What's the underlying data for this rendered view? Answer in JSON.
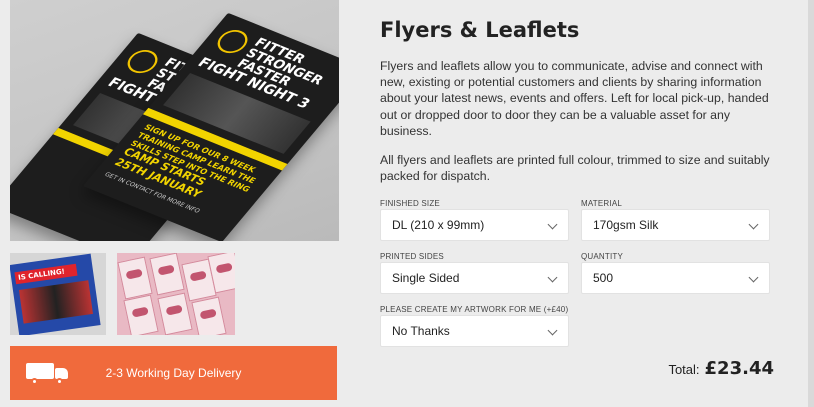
{
  "product": {
    "title": "Flyers & Leaflets",
    "description": "Flyers and leaflets allow you to communicate, advise and connect with new, existing or potential customers and clients by sharing information about your latest news, events and offers. Left for local pick-up, handed out or dropped door to door they can be a valuable asset for any business.",
    "description2": "All flyers and leaflets are printed full colour, trimmed to size and suitably packed for dispatch."
  },
  "gallery": {
    "main_image_icon": "flyer-photo",
    "flyer": {
      "headline": "FITTER STRONGER FASTER",
      "event": "FIGHT NIGHT 3",
      "promo": "SIGN UP FOR OUR 8 WEEK TRAINING CAMP LEARN THE SKILLS STEP INTO THE RING",
      "camp_starts": "CAMP STARTS",
      "date": "25TH JANUARY",
      "contact": "GET IN CONTACT FOR MORE INFO"
    },
    "thumb1_text": "IS CALLING!"
  },
  "delivery": {
    "label": "2-3 Working Day Delivery",
    "icon": "truck-icon",
    "color": "#f06a3c"
  },
  "options": {
    "finished_size": {
      "label": "FINISHED SIZE",
      "value": "DL (210 x 99mm)"
    },
    "material": {
      "label": "MATERIAL",
      "value": "170gsm Silk"
    },
    "printed_sides": {
      "label": "PRINTED SIDES",
      "value": "Single Sided"
    },
    "quantity": {
      "label": "QUANTITY",
      "value": "500"
    },
    "artwork": {
      "label": "PLEASE CREATE MY ARTWORK FOR ME (+£40)",
      "value": "No Thanks"
    }
  },
  "total": {
    "label": "Total:",
    "value": "£23.44"
  }
}
